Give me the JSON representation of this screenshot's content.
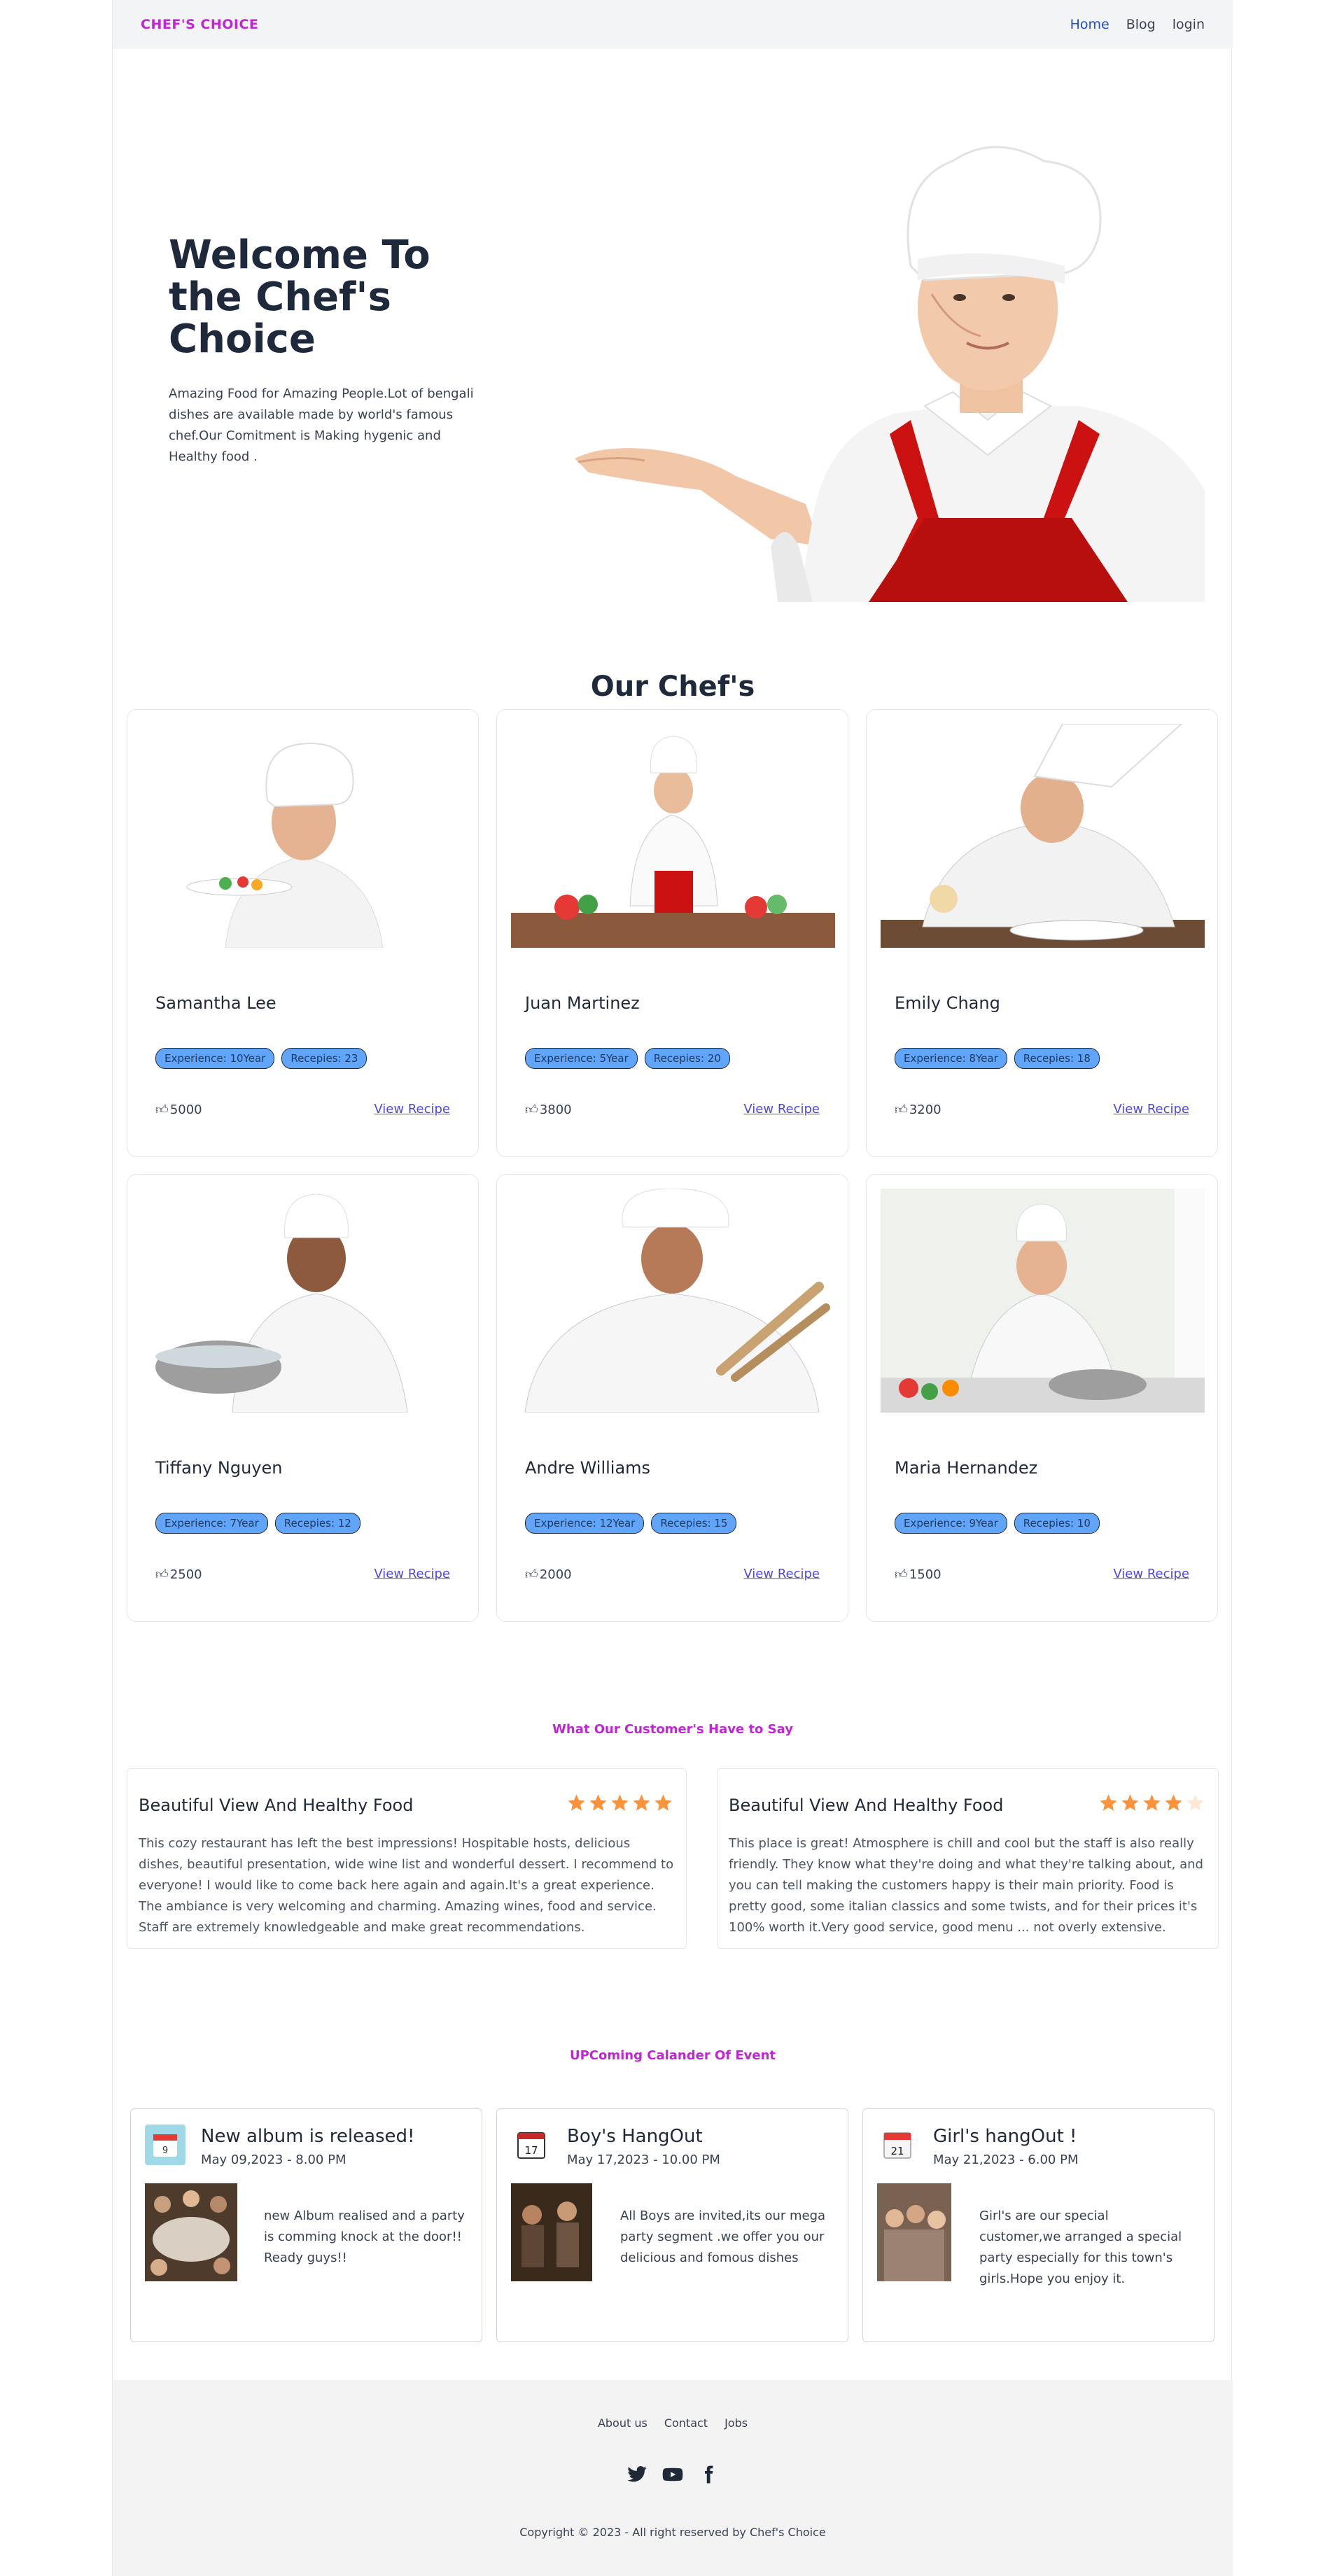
{
  "nav": {
    "brand": "CHEF'S CHOICE",
    "links": [
      "Home",
      "Blog",
      "login"
    ]
  },
  "hero": {
    "title": "Welcome To the Chef's Choice",
    "text": "Amazing Food for Amazing People.Lot of bengali dishes are available made by world's famous chef.Our Comitment is Making hygenic and Healthy food ."
  },
  "chefs_section": {
    "title": "Our Chef's",
    "view_label": "View Recipe",
    "chefs": [
      {
        "name": "Samantha Lee",
        "experience": "Experience: 10Year",
        "recipes": "Recepies: 23",
        "likes": "5000"
      },
      {
        "name": "Juan Martinez",
        "experience": "Experience: 5Year",
        "recipes": "Recepies: 20",
        "likes": "3800"
      },
      {
        "name": "Emily Chang",
        "experience": "Experience: 8Year",
        "recipes": "Recepies: 18",
        "likes": "3200"
      },
      {
        "name": "Tiffany Nguyen",
        "experience": "Experience: 7Year",
        "recipes": "Recepies: 12",
        "likes": "2500"
      },
      {
        "name": "Andre Williams",
        "experience": "Experience: 12Year",
        "recipes": "Recepies: 15",
        "likes": "2000"
      },
      {
        "name": "Maria Hernandez",
        "experience": "Experience: 9Year",
        "recipes": "Recepies: 10",
        "likes": "1500"
      }
    ]
  },
  "testimonials": {
    "title": "What Our Customer's Have to Say",
    "reviews": [
      {
        "title": "Beautiful View And Healthy Food",
        "rating": 5,
        "text": "This cozy restaurant has left the best impressions! Hospitable hosts, delicious dishes, beautiful presentation, wide wine list and wonderful dessert. I recommend to everyone! I would like to come back here again and again.It's a great experience. The ambiance is very welcoming and charming. Amazing wines, food and service. Staff are extremely knowledgeable and make great recommendations."
      },
      {
        "title": "Beautiful View And Healthy Food",
        "rating": 4,
        "text": "This place is great! Atmosphere is chill and cool but the staff is also really friendly. They know what they're doing and what they're talking about, and you can tell making the customers happy is their main priority. Food is pretty good, some italian classics and some twists, and for their prices it's 100% worth it.Very good service, good menu ... not overly extensive."
      }
    ]
  },
  "events": {
    "title": "UPComing Calander Of Event",
    "items": [
      {
        "title": "New album is released!",
        "date": "May 09,2023 - 8.00 PM",
        "cal_day": "9",
        "text": "new Album realised and a party is comming knock at the door!! Ready guys!!"
      },
      {
        "title": "Boy's HangOut",
        "date": "May 17,2023 - 10.00 PM",
        "cal_day": "17",
        "text": "All Boys are invited,its our mega party segment .we offer you our delicious and fomous dishes"
      },
      {
        "title": "Girl's hangOut !",
        "date": "May 21,2023 - 6.00 PM",
        "cal_day": "21",
        "text": "Girl's are our special customer,we arranged a special party especially for this town's girls.Hope you enjoy it."
      }
    ]
  },
  "footer": {
    "links": [
      "About us",
      "Contact",
      "Jobs"
    ],
    "socials": [
      "twitter-icon",
      "youtube-icon",
      "facebook-icon"
    ],
    "copyright": "Copyright © 2023 - All right reserved by Chef's Choice"
  },
  "colors": {
    "accent": "#c026d3",
    "nav_active": "#1d4ed8",
    "tag": "#60a5fa",
    "star": "#fb923c",
    "apron": "#cc1111"
  }
}
